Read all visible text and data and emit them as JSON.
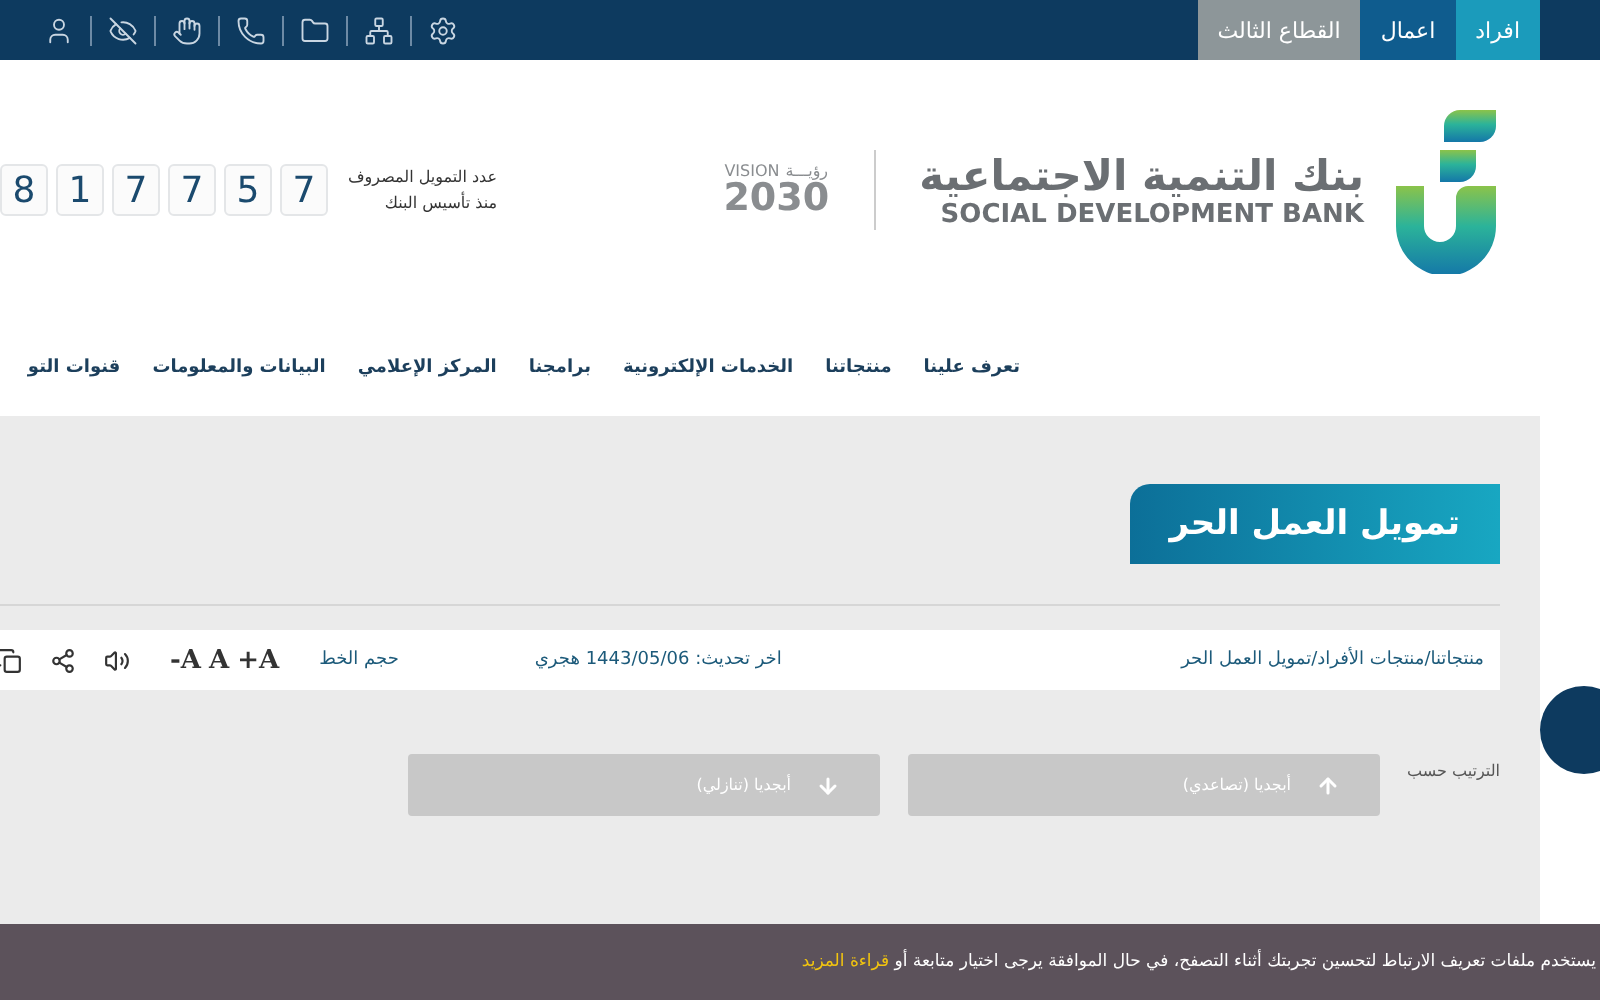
{
  "top_bar": {
    "tabs": [
      {
        "label": "افراد",
        "selected": true
      },
      {
        "label": "اعمال",
        "selected": false
      },
      {
        "label": "القطاع الثالث",
        "selected": false
      }
    ]
  },
  "header": {
    "bank_name_ar": "بنك التنمية الاجتماعية",
    "bank_name_en": "SOCIAL DEVELOPMENT BANK",
    "vision": {
      "ar": "رؤيـــة",
      "en": "VISION",
      "year": "2030"
    },
    "counter": {
      "label": "عدد التمويل المصروف",
      "sublabel": "منذ تأسيس البنك",
      "digits": [
        "7",
        "5",
        "7",
        "7",
        "1",
        "8"
      ]
    }
  },
  "nav": {
    "items": [
      "تعرف علينا",
      "منتجاتنا",
      "الخدمات الإلكترونية",
      "برامجنا",
      "المركز الإعلامي",
      "البيانات والمعلومات",
      "قنوات التو"
    ]
  },
  "page": {
    "title": "تمويل العمل الحر",
    "breadcrumb": "منتجاتنا/منتجات الأفراد/تمويل العمل الحر",
    "updated": "اخر تحديث: 1443/05/06 هجري",
    "font_size_label": "حجم الخط",
    "font_buttons": [
      "+A",
      "A",
      "-A"
    ],
    "sort": {
      "label": "الترتيب حسب",
      "options": [
        {
          "label": "أبجديا (تصاعدي)",
          "kind": "up"
        },
        {
          "label": "أبجديا (تنازلي)",
          "kind": "down"
        }
      ]
    }
  },
  "cookie_bar": {
    "text": "يستخدم ملفات تعريف الارتباط لتحسين تجربتك أثناء التصفح، في حال الموافقة يرجى اختيار متابعة أو",
    "link": "قراءة المزيد"
  }
}
